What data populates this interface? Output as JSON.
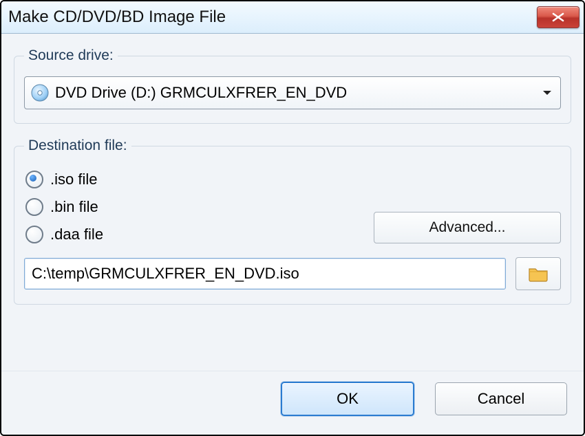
{
  "window": {
    "title": "Make CD/DVD/BD Image File"
  },
  "source": {
    "legend": "Source drive:",
    "selected": "DVD Drive (D:) GRMCULXFRER_EN_DVD"
  },
  "destination": {
    "legend": "Destination file:",
    "options": {
      "iso": ".iso file",
      "bin": ".bin file",
      "daa": ".daa file"
    },
    "selected": "iso",
    "advanced_label": "Advanced...",
    "path_value": "C:\\temp\\GRMCULXFRER_EN_DVD.iso"
  },
  "buttons": {
    "ok": "OK",
    "cancel": "Cancel"
  }
}
